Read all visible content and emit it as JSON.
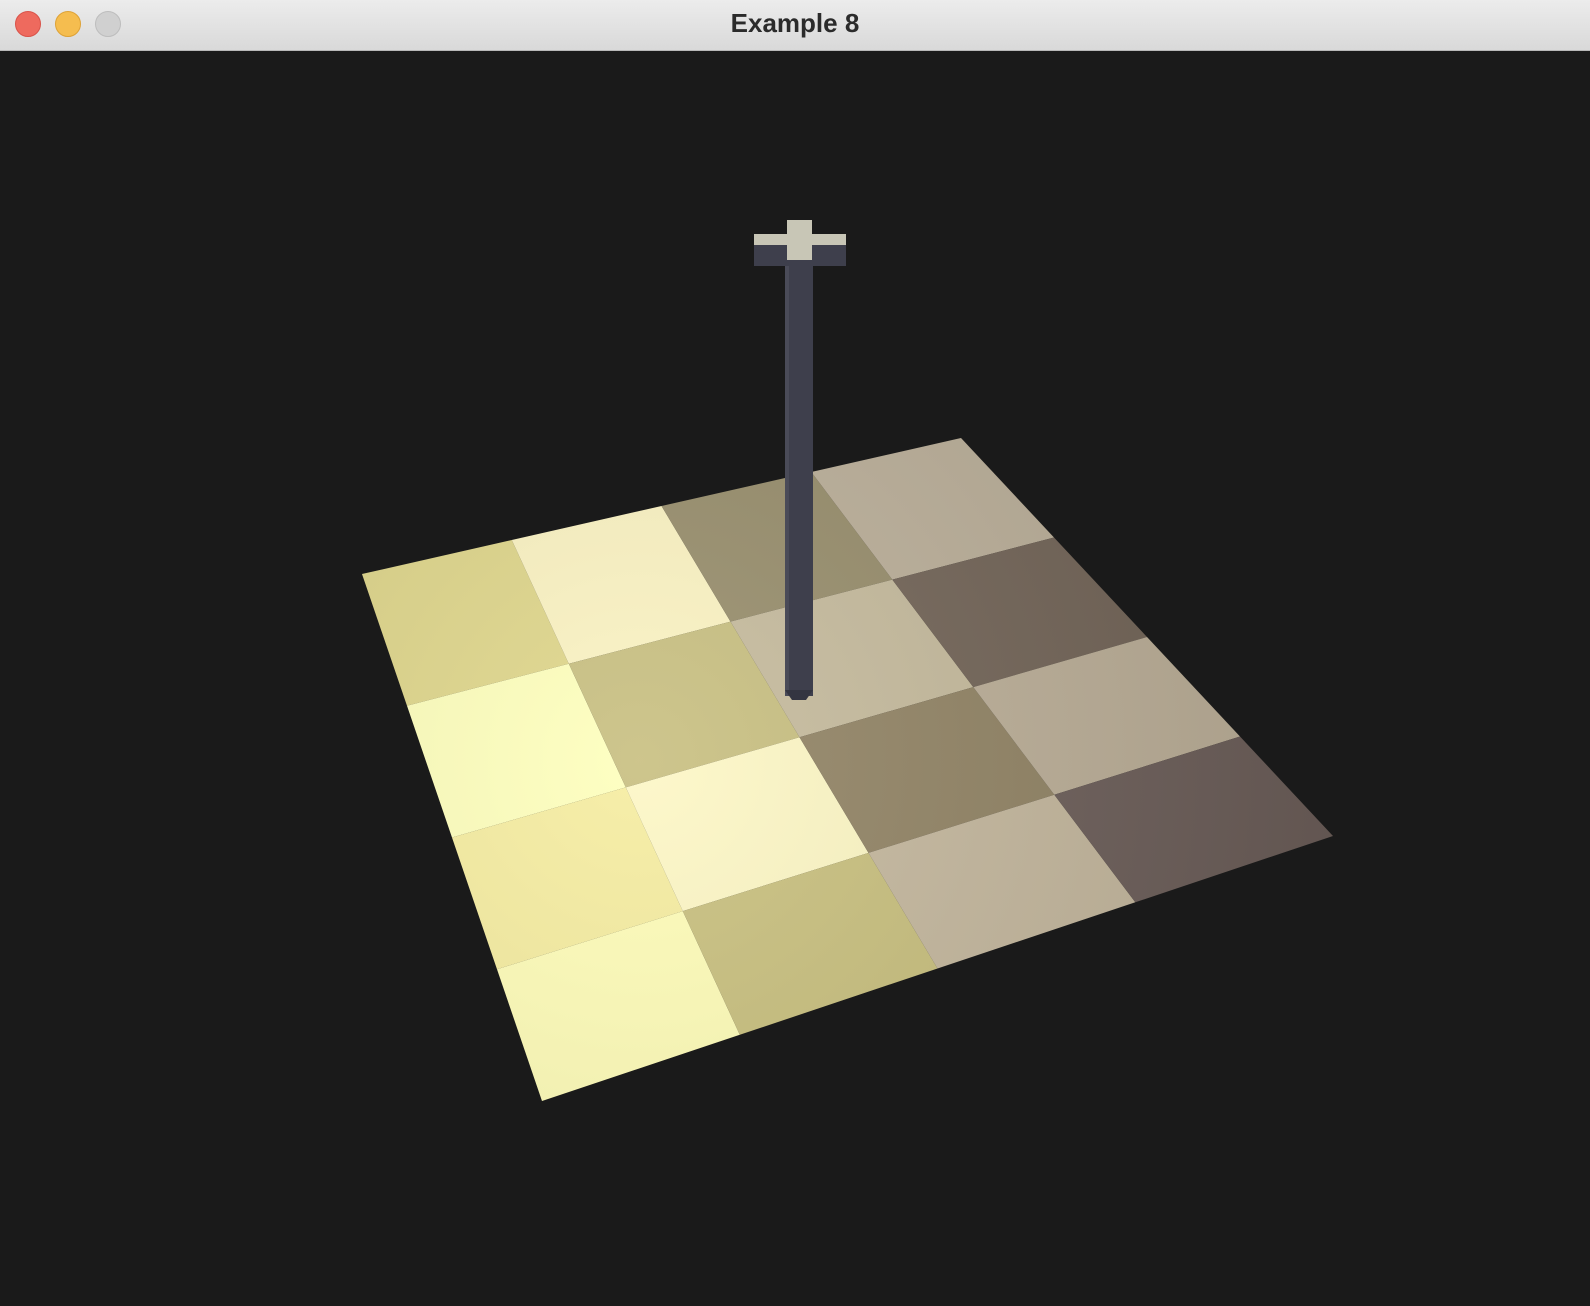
{
  "window": {
    "title": "Example 8"
  },
  "titlebar": {
    "buttons": [
      {
        "name": "close",
        "color": "#ee6a5e"
      },
      {
        "name": "minimize",
        "color": "#f5bd4f"
      },
      {
        "name": "zoom",
        "color": "#d0d0d0"
      }
    ]
  },
  "scene": {
    "background_color": "#1a1a1a",
    "floor": {
      "rows": 4,
      "cols": 4,
      "light_color": "#fffdb8",
      "dark_color": "#6d5f5a"
    },
    "pole": {
      "color": "#3e3f4c",
      "cap_color": "#c8c6b6"
    }
  }
}
